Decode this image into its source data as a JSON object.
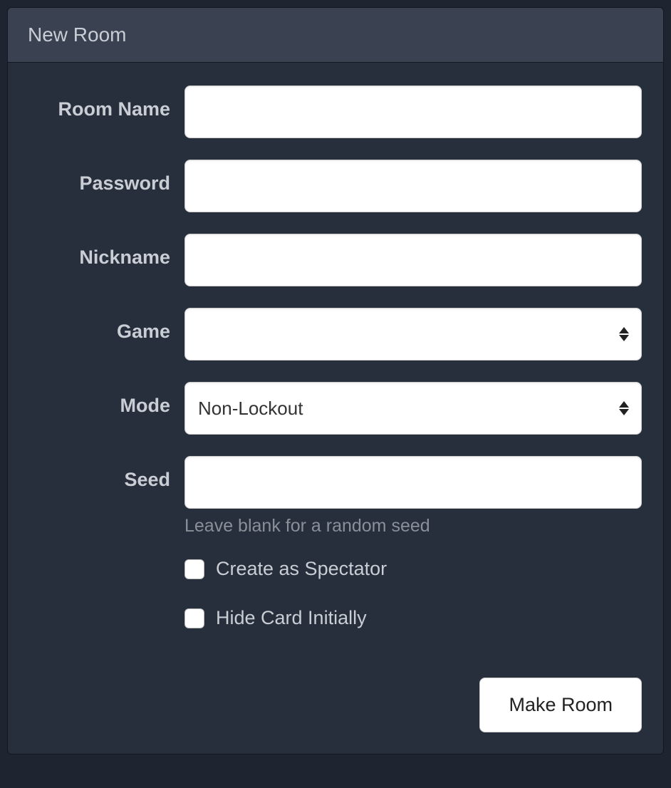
{
  "panel": {
    "title": "New Room"
  },
  "form": {
    "roomName": {
      "label": "Room Name",
      "value": ""
    },
    "password": {
      "label": "Password",
      "value": ""
    },
    "nickname": {
      "label": "Nickname",
      "value": ""
    },
    "game": {
      "label": "Game",
      "selected": ""
    },
    "mode": {
      "label": "Mode",
      "selected": "Non-Lockout"
    },
    "seed": {
      "label": "Seed",
      "value": "",
      "help": "Leave blank for a random seed"
    },
    "spectator": {
      "label": "Create as Spectator",
      "checked": false
    },
    "hideCard": {
      "label": "Hide Card Initially",
      "checked": false
    },
    "submit": {
      "label": "Make Room"
    }
  }
}
